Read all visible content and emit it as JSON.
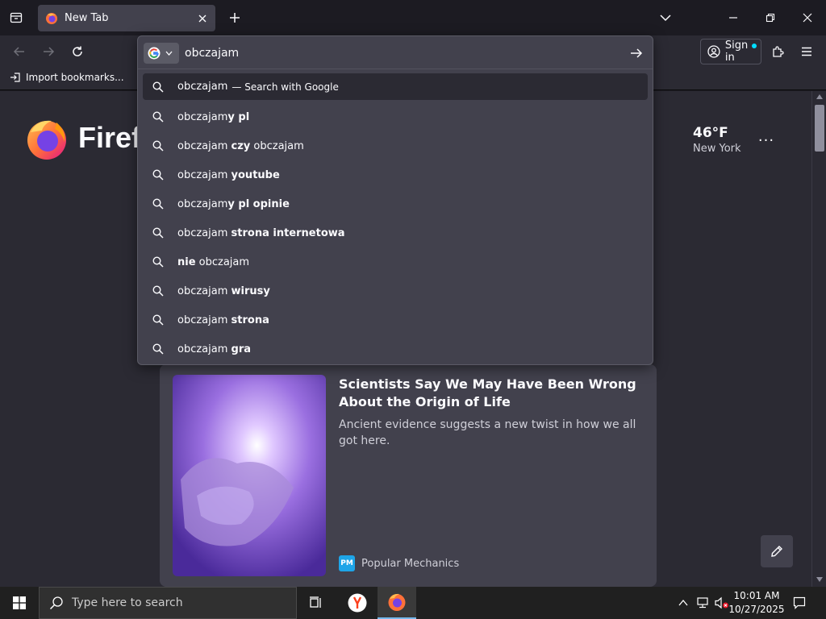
{
  "browser": {
    "tab": {
      "title": "New Tab"
    },
    "signin_label": "Sign in",
    "bookmarks": [
      {
        "label": "Import bookmarks..."
      }
    ]
  },
  "urlbar": {
    "value": "obczajam",
    "engine_icon": "google-g-icon",
    "suggestions": [
      {
        "pre": "obczajam",
        "bold": "",
        "post": "",
        "action": "— Search with Google"
      },
      {
        "pre": "obczajam",
        "bold": "y pl",
        "post": ""
      },
      {
        "pre": "obczajam ",
        "bold": "czy",
        "post": " obczajam"
      },
      {
        "pre": "obczajam ",
        "bold": "youtube",
        "post": ""
      },
      {
        "pre": "obczajam",
        "bold": "y pl opinie",
        "post": ""
      },
      {
        "pre": "obczajam ",
        "bold": "strona internetowa",
        "post": ""
      },
      {
        "pre": "",
        "bold": "nie",
        "post": " obczajam"
      },
      {
        "pre": "obczajam ",
        "bold": "wirusy",
        "post": ""
      },
      {
        "pre": "obczajam ",
        "bold": "strona",
        "post": ""
      },
      {
        "pre": "obczajam ",
        "bold": "gra",
        "post": ""
      }
    ]
  },
  "newtab": {
    "brand": "Firefox",
    "weather": {
      "temp": "46°F",
      "location": "New York"
    },
    "more_label": "···",
    "story": {
      "title": "Scientists Say We May Have Been Wrong About the Origin of Life",
      "description": "Ancient evidence suggests a new twist in how we all got here.",
      "source": "Popular Mechanics",
      "source_logo": "PM"
    }
  },
  "taskbar": {
    "search_placeholder": "Type here to search",
    "time": "10:01 AM",
    "date": "10/27/2025"
  },
  "colors": {
    "accent": "#00ddff",
    "toolbar": "#2b2a33",
    "popup": "#42414d",
    "taskbar": "#202020"
  }
}
